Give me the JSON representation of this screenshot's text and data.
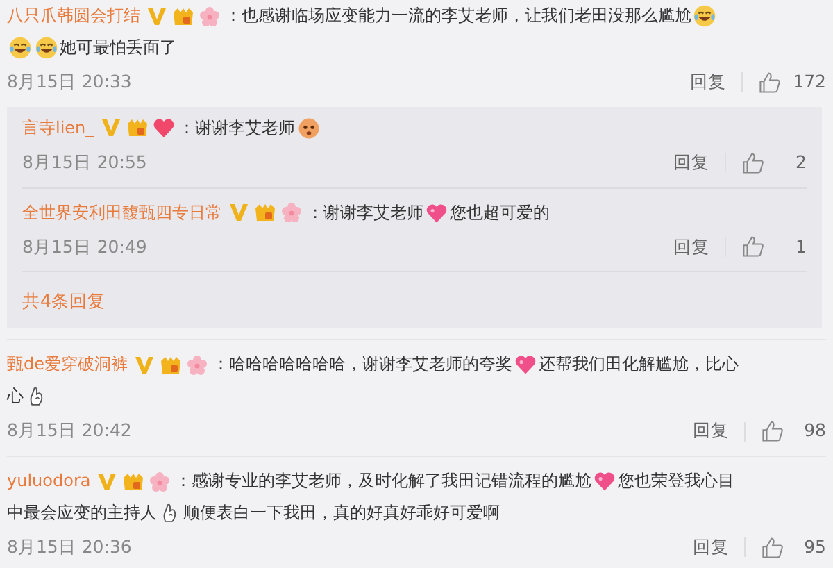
{
  "comments": [
    {
      "user": "八只爪韩圆会打结",
      "badges": [
        {
          "kind": "verified"
        },
        {
          "kind": "member"
        },
        {
          "kind": "flower"
        }
      ],
      "lines": [
        [
          {
            "kind": "text",
            "text": "：也感谢临场应变能力一流的李艾老师，让我们老田没那么尴尬"
          },
          {
            "kind": "laugh"
          }
        ],
        [
          {
            "kind": "laugh"
          },
          {
            "kind": "laugh"
          },
          {
            "kind": "text",
            "text": "她可最怕丢面了"
          }
        ]
      ],
      "time": "8月15日 20:33",
      "reply_label": "回复",
      "likes": "172",
      "replies": [
        {
          "user": "言寺lien_",
          "badges": [
            {
              "kind": "verified"
            },
            {
              "kind": "member"
            },
            {
              "kind": "heart"
            }
          ],
          "lines": [
            [
              {
                "kind": "text",
                "text": "：谢谢李艾老师"
              },
              {
                "kind": "face"
              }
            ]
          ],
          "time": "8月15日 20:55",
          "reply_label": "回复",
          "likes": "2"
        },
        {
          "user": "全世界安利田馥甄四专日常",
          "badges": [
            {
              "kind": "verified"
            },
            {
              "kind": "member"
            },
            {
              "kind": "flower"
            }
          ],
          "lines": [
            [
              {
                "kind": "text",
                "text": "：谢谢李艾老师"
              },
              {
                "kind": "heart"
              },
              {
                "kind": "text",
                "text": "您也超可爱的"
              }
            ]
          ],
          "time": "8月15日 20:49",
          "reply_label": "回复",
          "likes": "1"
        }
      ],
      "more_replies": "共4条回复"
    },
    {
      "user": "甄de爱穿破洞裤",
      "badges": [
        {
          "kind": "verified"
        },
        {
          "kind": "member"
        },
        {
          "kind": "flower"
        }
      ],
      "lines": [
        [
          {
            "kind": "text",
            "text": "：哈哈哈哈哈哈哈，谢谢李艾老师的夸奖"
          },
          {
            "kind": "heart"
          },
          {
            "kind": "text",
            "text": "还帮我们田化解尴尬，比心"
          }
        ],
        [
          {
            "kind": "text",
            "text": "心"
          },
          {
            "kind": "hand"
          }
        ]
      ],
      "time": "8月15日 20:42",
      "reply_label": "回复",
      "likes": "98"
    },
    {
      "user": "yuluodora",
      "badges": [
        {
          "kind": "verified"
        },
        {
          "kind": "member"
        },
        {
          "kind": "flower"
        }
      ],
      "lines": [
        [
          {
            "kind": "text",
            "text": "：感谢专业的李艾老师，及时化解了我田记错流程的尴尬"
          },
          {
            "kind": "heart"
          },
          {
            "kind": "text",
            "text": "您也荣登我心目"
          }
        ],
        [
          {
            "kind": "text",
            "text": "中最会应变的主持人"
          },
          {
            "kind": "hand"
          },
          {
            "kind": "text",
            "text": "顺便表白一下我田，真的好真好乖好可爱啊"
          }
        ]
      ],
      "time": "8月15日 20:36",
      "reply_label": "回复",
      "likes": "95"
    }
  ]
}
